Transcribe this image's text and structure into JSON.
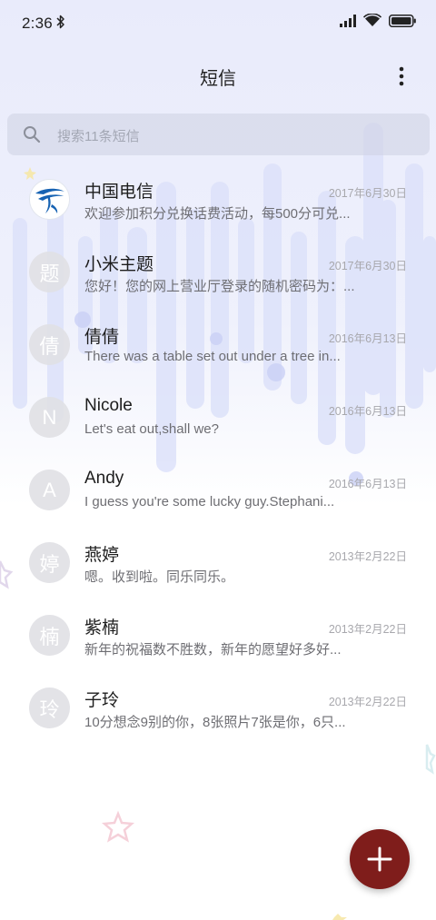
{
  "status_bar": {
    "time": "2:36"
  },
  "header": {
    "title": "短信"
  },
  "search": {
    "placeholder": "搜索11条短信"
  },
  "conversations": [
    {
      "name": "中国电信",
      "date": "2017年6月30日",
      "preview": "欢迎参加积分兑换话费活动，每500分可兑...",
      "avatar": "china-telecom-logo"
    },
    {
      "name": "小米主题",
      "date": "2017年6月30日",
      "preview": "您好！您的网上营业厅登录的随机密码为：...",
      "avatar": "题"
    },
    {
      "name": "倩倩",
      "date": "2016年6月13日",
      "preview": "There was a table set out under a tree in...",
      "avatar": "倩"
    },
    {
      "name": "Nicole",
      "date": "2016年6月13日",
      "preview": "Let's eat out,shall we?",
      "avatar": "N"
    },
    {
      "name": "Andy",
      "date": "2016年6月13日",
      "preview": "I guess you're some lucky guy.Stephani...",
      "avatar": "A"
    },
    {
      "name": "燕婷",
      "date": "2013年2月22日",
      "preview": "嗯。收到啦。同乐同乐。",
      "avatar": "婷"
    },
    {
      "name": "紫楠",
      "date": "2013年2月22日",
      "preview": "新年的祝福数不胜数，新年的愿望好多好...",
      "avatar": "楠"
    },
    {
      "name": "子玲",
      "date": "2013年2月22日",
      "preview": "10分想念9别的你，8张照片7张是你，6只...",
      "avatar": "玲"
    }
  ],
  "colors": {
    "fab": "#7f1d1b",
    "avatar_bg": "#e0e0e4",
    "decor": "#dfe3fb"
  },
  "icons": {
    "status": [
      "bluetooth-icon",
      "signal-icon",
      "wifi-icon",
      "battery-icon"
    ],
    "header": [
      "more-vert-icon"
    ],
    "search": "search-icon",
    "fab": "plus-icon"
  }
}
